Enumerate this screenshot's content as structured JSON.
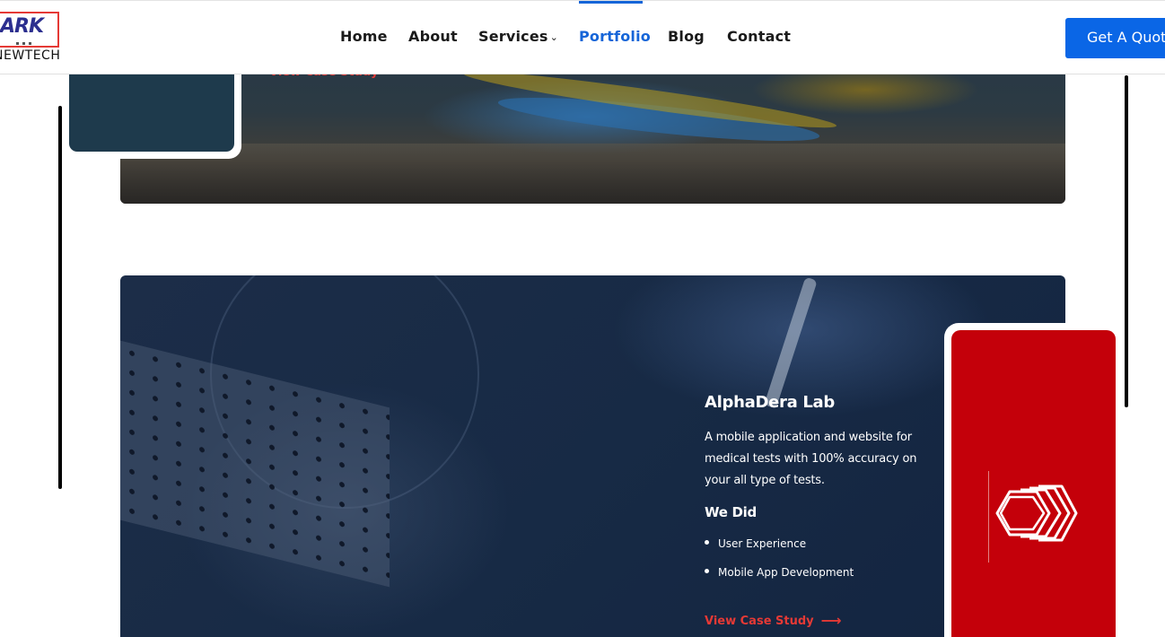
{
  "header": {
    "logo": {
      "mark": "ARK",
      "word": "NEWTECH"
    },
    "nav": [
      {
        "label": "Home"
      },
      {
        "label": "About"
      },
      {
        "label": "Services"
      },
      {
        "label": "Portfolio",
        "active": true
      },
      {
        "label": "Blog"
      },
      {
        "label": "Contact"
      }
    ],
    "quote_button": "Get A Quote"
  },
  "previous_case": {
    "cta": "View Case Study"
  },
  "case": {
    "title": "AlphaDera Lab",
    "description": "A mobile application and website for medical tests with 100% accuracy on your all type of tests.",
    "we_did_heading": "We Did",
    "services": [
      "User Experience",
      "Mobile App Development"
    ],
    "cta": "View Case Study",
    "phone_color": "#c4000a"
  },
  "colors": {
    "accent": "#1565d8",
    "cta_red": "#e53935",
    "button_blue": "#0a66e6"
  },
  "icons": {
    "services_chevron": "chevron-down-icon",
    "cta_arrow": "arrow-right-icon",
    "app_logo": "hexagon-layers-logo"
  }
}
